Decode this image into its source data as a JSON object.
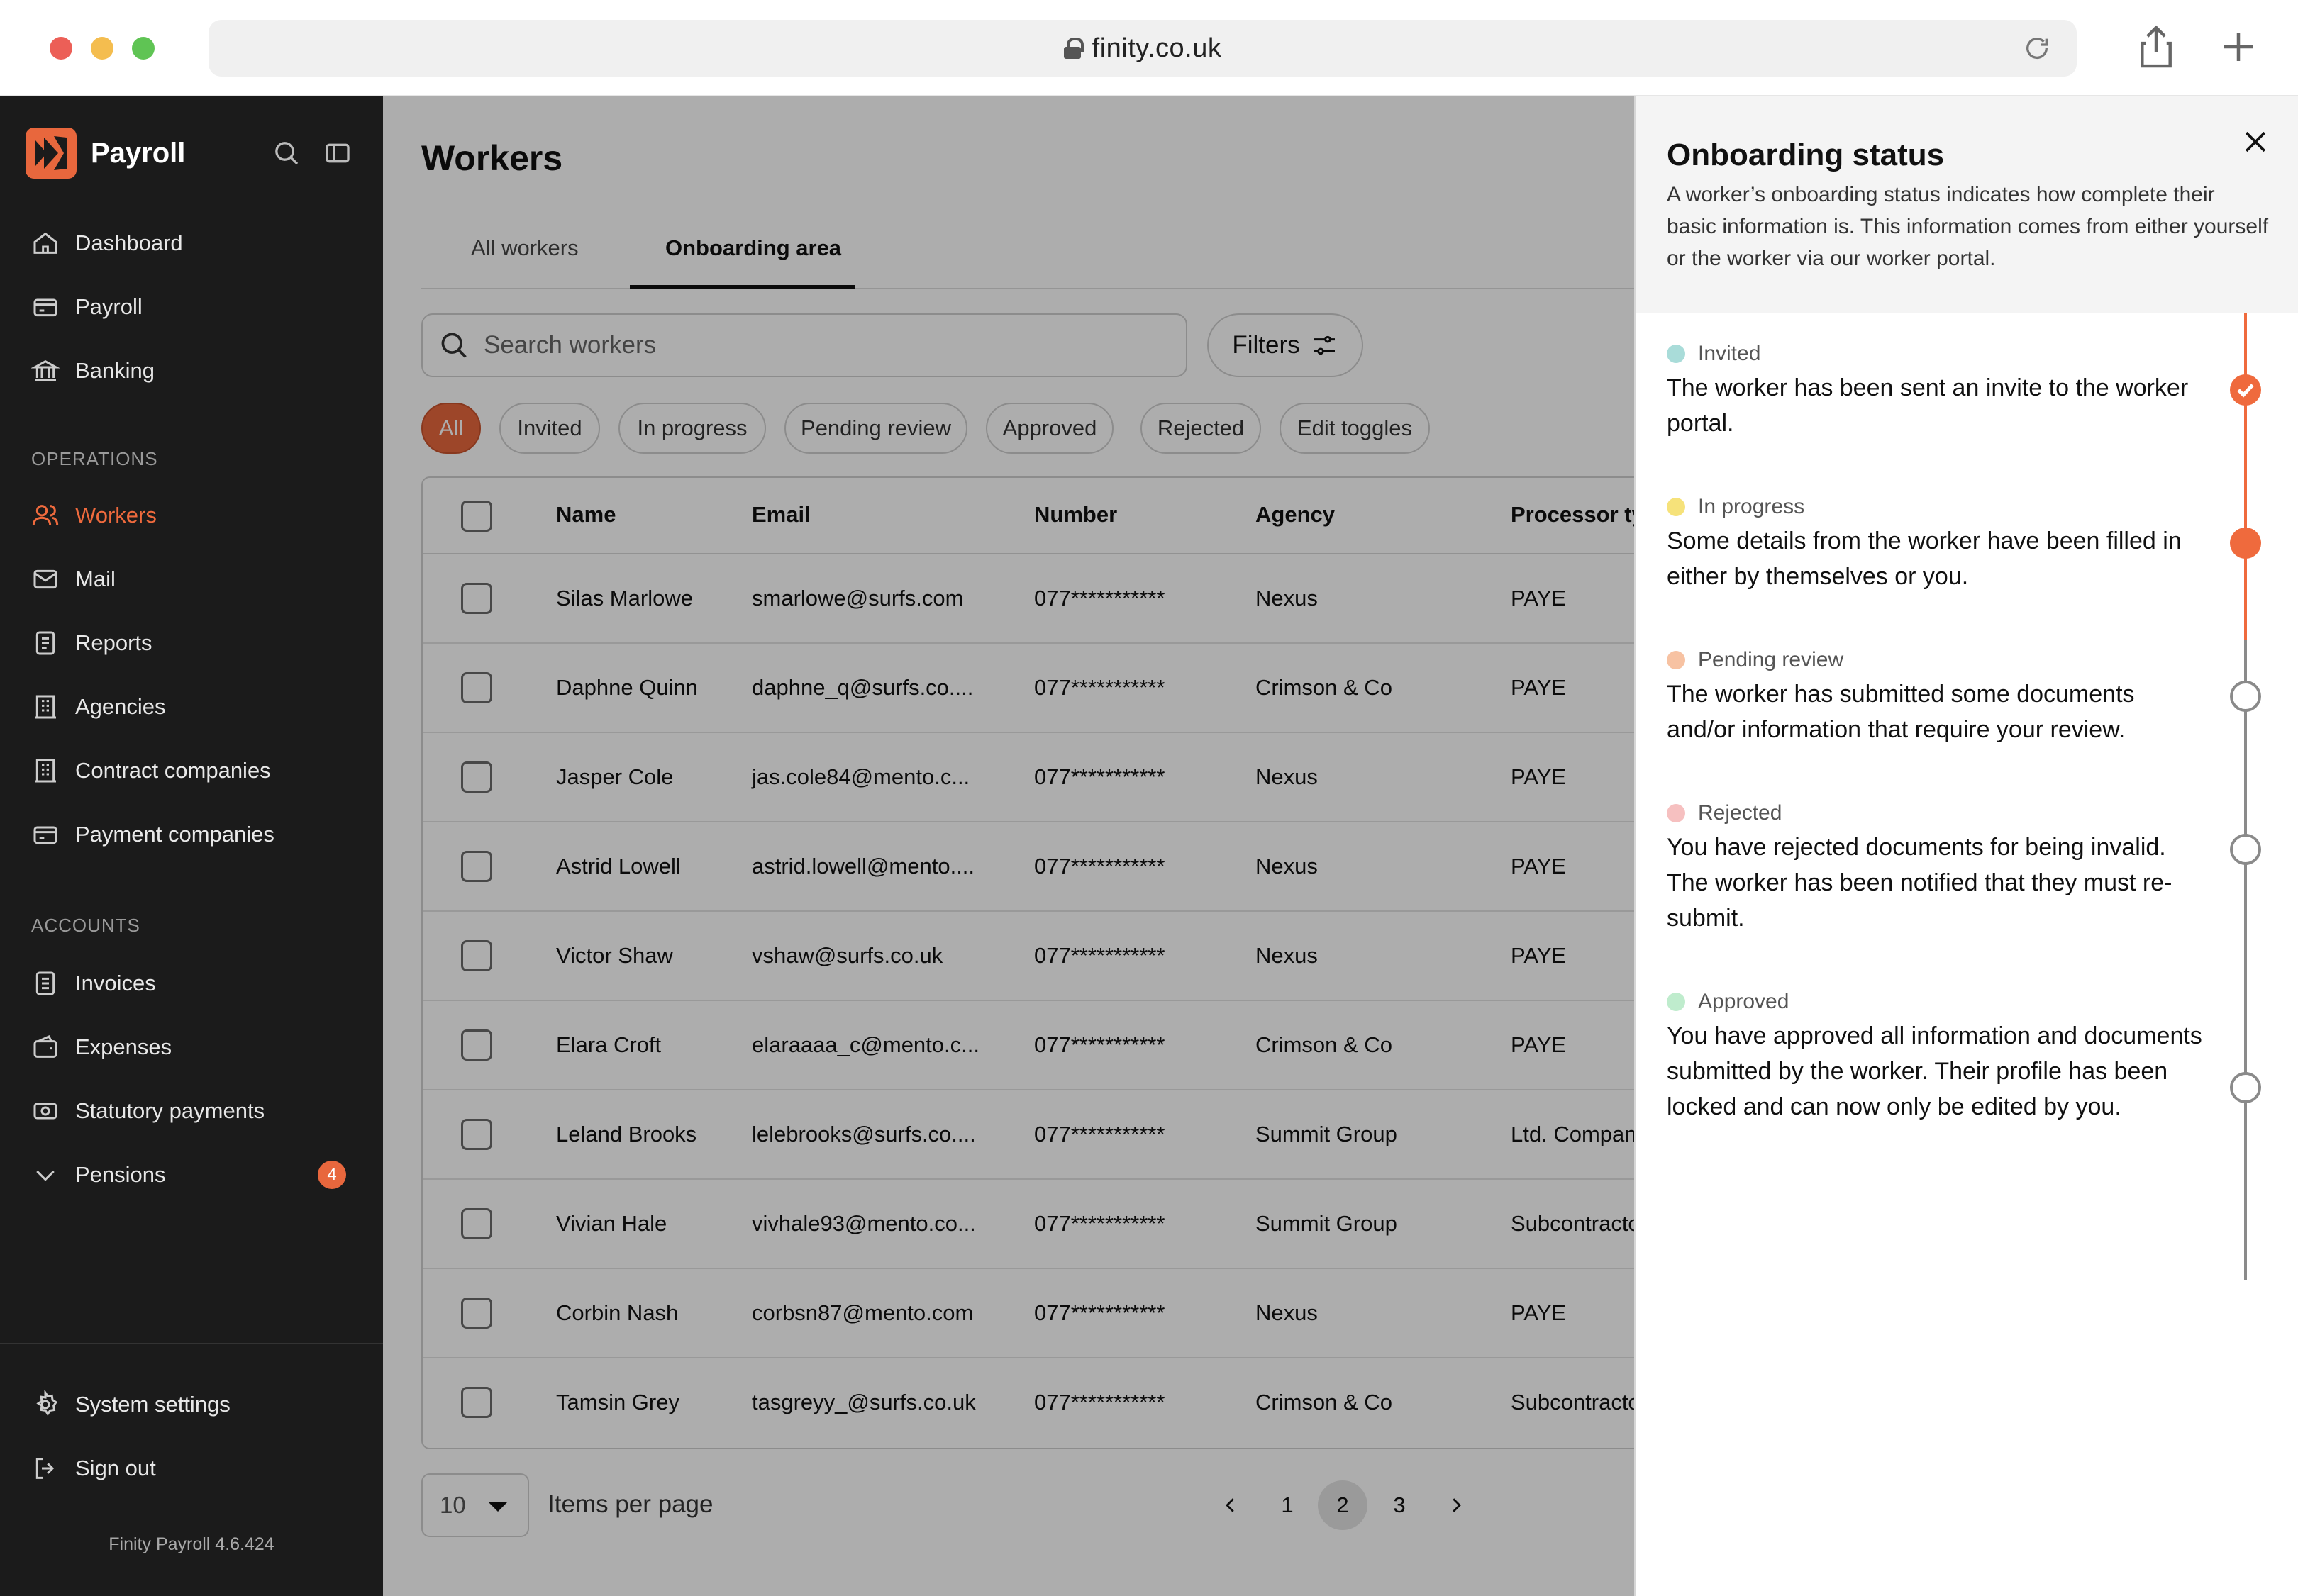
{
  "browser": {
    "url": "finity.co.uk"
  },
  "sidebar": {
    "brand": "Payroll",
    "nav_main": [
      {
        "label": "Dashboard",
        "icon": "home-icon"
      },
      {
        "label": "Payroll",
        "icon": "card-icon"
      },
      {
        "label": "Banking",
        "icon": "bank-icon"
      }
    ],
    "section_operations": "OPERATIONS",
    "nav_operations": [
      {
        "label": "Workers",
        "icon": "users-icon",
        "active": true
      },
      {
        "label": "Mail",
        "icon": "mail-icon"
      },
      {
        "label": "Reports",
        "icon": "report-icon"
      },
      {
        "label": "Agencies",
        "icon": "building-icon"
      },
      {
        "label": "Contract companies",
        "icon": "building-icon"
      },
      {
        "label": "Payment companies",
        "icon": "card-icon"
      }
    ],
    "section_accounts": "ACCOUNTS",
    "nav_accounts": [
      {
        "label": "Invoices",
        "icon": "invoice-icon"
      },
      {
        "label": "Expenses",
        "icon": "wallet-icon"
      },
      {
        "label": "Statutory payments",
        "icon": "cash-icon"
      },
      {
        "label": "Pensions",
        "icon": "chevron-down-icon",
        "badge": "4"
      }
    ],
    "footer": [
      {
        "label": "System settings",
        "icon": "gear-icon"
      },
      {
        "label": "Sign out",
        "icon": "sign-out-icon"
      }
    ],
    "version": "Finity Payroll 4.6.424"
  },
  "main": {
    "title": "Workers",
    "tabs": [
      {
        "label": "All workers",
        "active": false
      },
      {
        "label": "Onboarding area",
        "active": true
      }
    ],
    "search_placeholder": "Search workers",
    "filters_label": "Filters",
    "chips": [
      {
        "label": "All",
        "active": true
      },
      {
        "label": "Invited"
      },
      {
        "label": "In progress"
      },
      {
        "label": "Pending review"
      },
      {
        "label": "Approved"
      },
      {
        "label": "Rejected"
      },
      {
        "label": "Edit toggles"
      }
    ],
    "columns": [
      "Name",
      "Email",
      "Number",
      "Agency",
      "Processor type"
    ],
    "rows": [
      {
        "name": "Silas Marlowe",
        "email": "smarlowe@surfs.com",
        "number": "077***********",
        "agency": "Nexus",
        "processor": "PAYE"
      },
      {
        "name": "Daphne Quinn",
        "email": "daphne_q@surfs.co....",
        "number": "077***********",
        "agency": "Crimson & Co",
        "processor": "PAYE"
      },
      {
        "name": "Jasper Cole",
        "email": "jas.cole84@mento.c...",
        "number": "077***********",
        "agency": "Nexus",
        "processor": "PAYE"
      },
      {
        "name": "Astrid Lowell",
        "email": "astrid.lowell@mento....",
        "number": "077***********",
        "agency": "Nexus",
        "processor": "PAYE"
      },
      {
        "name": "Victor Shaw",
        "email": "vshaw@surfs.co.uk",
        "number": "077***********",
        "agency": "Nexus",
        "processor": "PAYE"
      },
      {
        "name": "Elara Croft",
        "email": "elaraaaa_c@mento.c...",
        "number": "077***********",
        "agency": "Crimson & Co",
        "processor": "PAYE"
      },
      {
        "name": "Leland Brooks",
        "email": "lelebrooks@surfs.co....",
        "number": "077***********",
        "agency": "Summit Group",
        "processor": "Ltd. Company"
      },
      {
        "name": "Vivian Hale",
        "email": "vivhale93@mento.co...",
        "number": "077***********",
        "agency": "Summit Group",
        "processor": "Subcontractor"
      },
      {
        "name": "Corbin Nash",
        "email": "corbsn87@mento.com",
        "number": "077***********",
        "agency": "Nexus",
        "processor": "PAYE"
      },
      {
        "name": "Tamsin Grey",
        "email": "tasgreyy_@surfs.co.uk",
        "number": "077***********",
        "agency": "Crimson & Co",
        "processor": "Subcontractor"
      }
    ],
    "per_page_value": "10",
    "per_page_label": "Items per page",
    "pages": [
      "1",
      "2",
      "3"
    ],
    "current_page": "2"
  },
  "panel": {
    "title": "Onboarding status",
    "description": "A worker’s onboarding status indicates how complete their basic information is. This information comes from either yourself or the worker via our worker portal.",
    "statuses": [
      {
        "label": "Invited",
        "text": "The worker has been sent an invite to the worker portal.",
        "dot_color": "#a9dcd9",
        "state": "done"
      },
      {
        "label": "In progress",
        "text": "Some details from the worker have been filled in either by themselves or you.",
        "dot_color": "#f6e27a",
        "state": "current"
      },
      {
        "label": "Pending review",
        "text": "The worker has submitted some documents and/or information that require your review.",
        "dot_color": "#f7c2a2",
        "state": "empty"
      },
      {
        "label": "Rejected",
        "text": "You have rejected documents for being invalid. The worker has been notified that they must re-submit.",
        "dot_color": "#f6c0c0",
        "state": "empty"
      },
      {
        "label": "Approved",
        "text": "You have approved all information and documents submitted by the worker. Their profile has been locked and can now only be edited by you.",
        "dot_color": "#bfeccd",
        "state": "empty"
      }
    ],
    "accent_color": "#ef6a3d"
  }
}
